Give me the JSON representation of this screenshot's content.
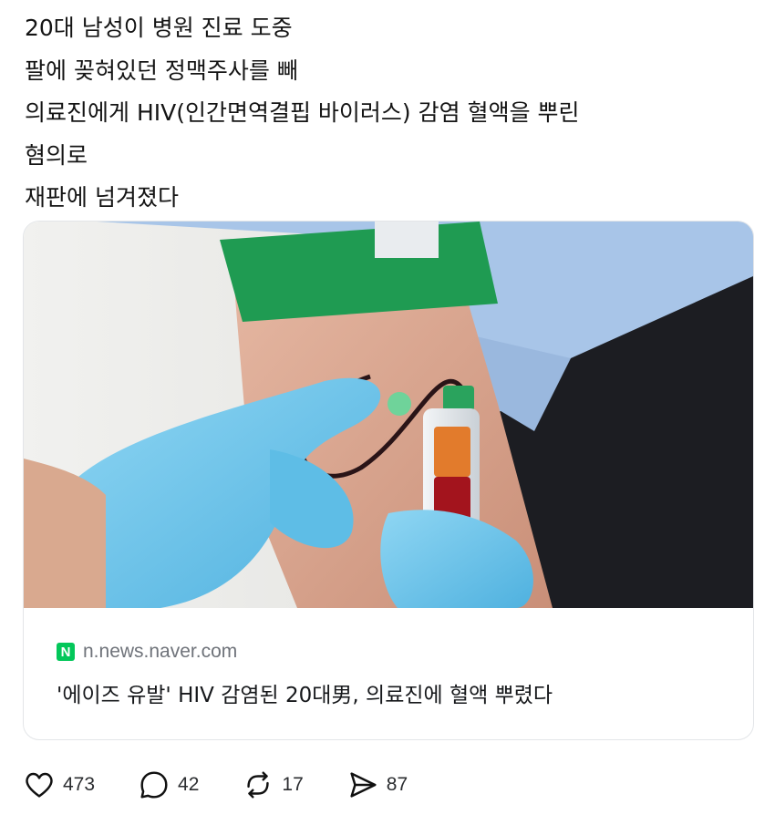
{
  "post": {
    "lines": [
      "20대 남성이 병원 진료 도중",
      "팔에 꽂혀있던 정맥주사를 빼",
      "의료진에게 HIV(인간면역결핍 바이러스) 감염 혈액을 뿌린",
      "혐의로",
      "재판에 넘겨졌다"
    ]
  },
  "card": {
    "source_badge": "N",
    "source_domain": "n.news.naver.com",
    "title": "'에이즈 유발' HIV 감염된 20대男, 의료진에 혈액 뿌렸다"
  },
  "actions": {
    "likes": "473",
    "replies": "42",
    "reposts": "17",
    "shares": "87"
  },
  "icons": {
    "like": "heart-icon",
    "reply": "speech-bubble-icon",
    "repost": "repost-arrows-icon",
    "share": "paper-plane-icon"
  },
  "colors": {
    "naver_green": "#03c75a",
    "glove_blue": "#6fc4ea",
    "tourniquet_green": "#1f9b52",
    "blood_red": "#a3141d"
  }
}
